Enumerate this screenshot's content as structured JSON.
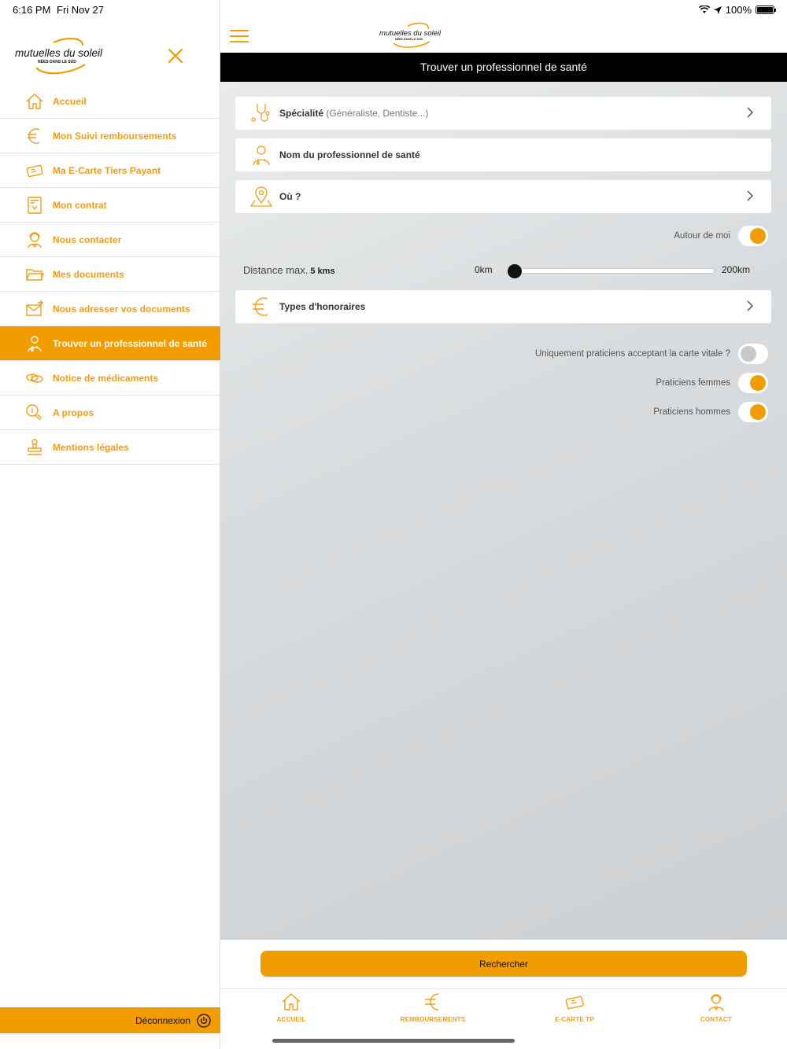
{
  "status_bar": {
    "time": "6:16 PM",
    "date": "Fri Nov 27",
    "battery": "100%"
  },
  "brand": {
    "name": "mutuelles du soleil",
    "tagline": "NÉES DANS LE SUD",
    "accent": "#f39c00"
  },
  "sidebar": {
    "items": [
      {
        "label": "Accueil",
        "icon": "home-icon",
        "active": false
      },
      {
        "label": "Mon Suivi remboursements",
        "icon": "euro-icon",
        "active": false
      },
      {
        "label": "Ma E-Carte Tiers Payant",
        "icon": "card-icon",
        "active": false
      },
      {
        "label": "Mon contrat",
        "icon": "contract-icon",
        "active": false
      },
      {
        "label": "Nous contacter",
        "icon": "headset-icon",
        "active": false
      },
      {
        "label": "Mes documents",
        "icon": "folder-icon",
        "active": false
      },
      {
        "label": "Nous adresser vos documents",
        "icon": "send-mail-icon",
        "active": false
      },
      {
        "label": "Trouver un professionnel de santé",
        "icon": "doctor-icon",
        "active": true
      },
      {
        "label": "Notice de médicaments",
        "icon": "pills-icon",
        "active": false
      },
      {
        "label": "A propos",
        "icon": "info-icon",
        "active": false
      },
      {
        "label": "Mentions légales",
        "icon": "stamp-icon",
        "active": false
      }
    ],
    "logout_label": "Déconnexion"
  },
  "main": {
    "title": "Trouver un professionnel de santé",
    "fields": {
      "specialite_label": "Spécialité",
      "specialite_hint": "(Généraliste, Dentiste...)",
      "nom_label": "Nom du professionnel de santé",
      "ou_label": "Où ?",
      "honoraires_label": "Types d'honoraires"
    },
    "autour_label": "Autour de moi",
    "autour_on": true,
    "distance": {
      "label": "Distance max.",
      "value": "5 kms",
      "min_label": "0km",
      "max_label": "200km",
      "min": 0,
      "max": 200,
      "current": 5
    },
    "toggles": [
      {
        "label": "Uniquement praticiens acceptant la carte vitale ?",
        "on": false
      },
      {
        "label": "Praticiens femmes",
        "on": true
      },
      {
        "label": "Praticiens hommes",
        "on": true
      }
    ],
    "search_button": "Rechercher"
  },
  "tabbar": [
    {
      "label": "ACCUEIL",
      "icon": "home-icon"
    },
    {
      "label": "REMBOURSEMENTS",
      "icon": "euro-icon"
    },
    {
      "label": "E-CARTE TP",
      "icon": "card-icon"
    },
    {
      "label": "CONTACT",
      "icon": "headset-icon"
    }
  ]
}
